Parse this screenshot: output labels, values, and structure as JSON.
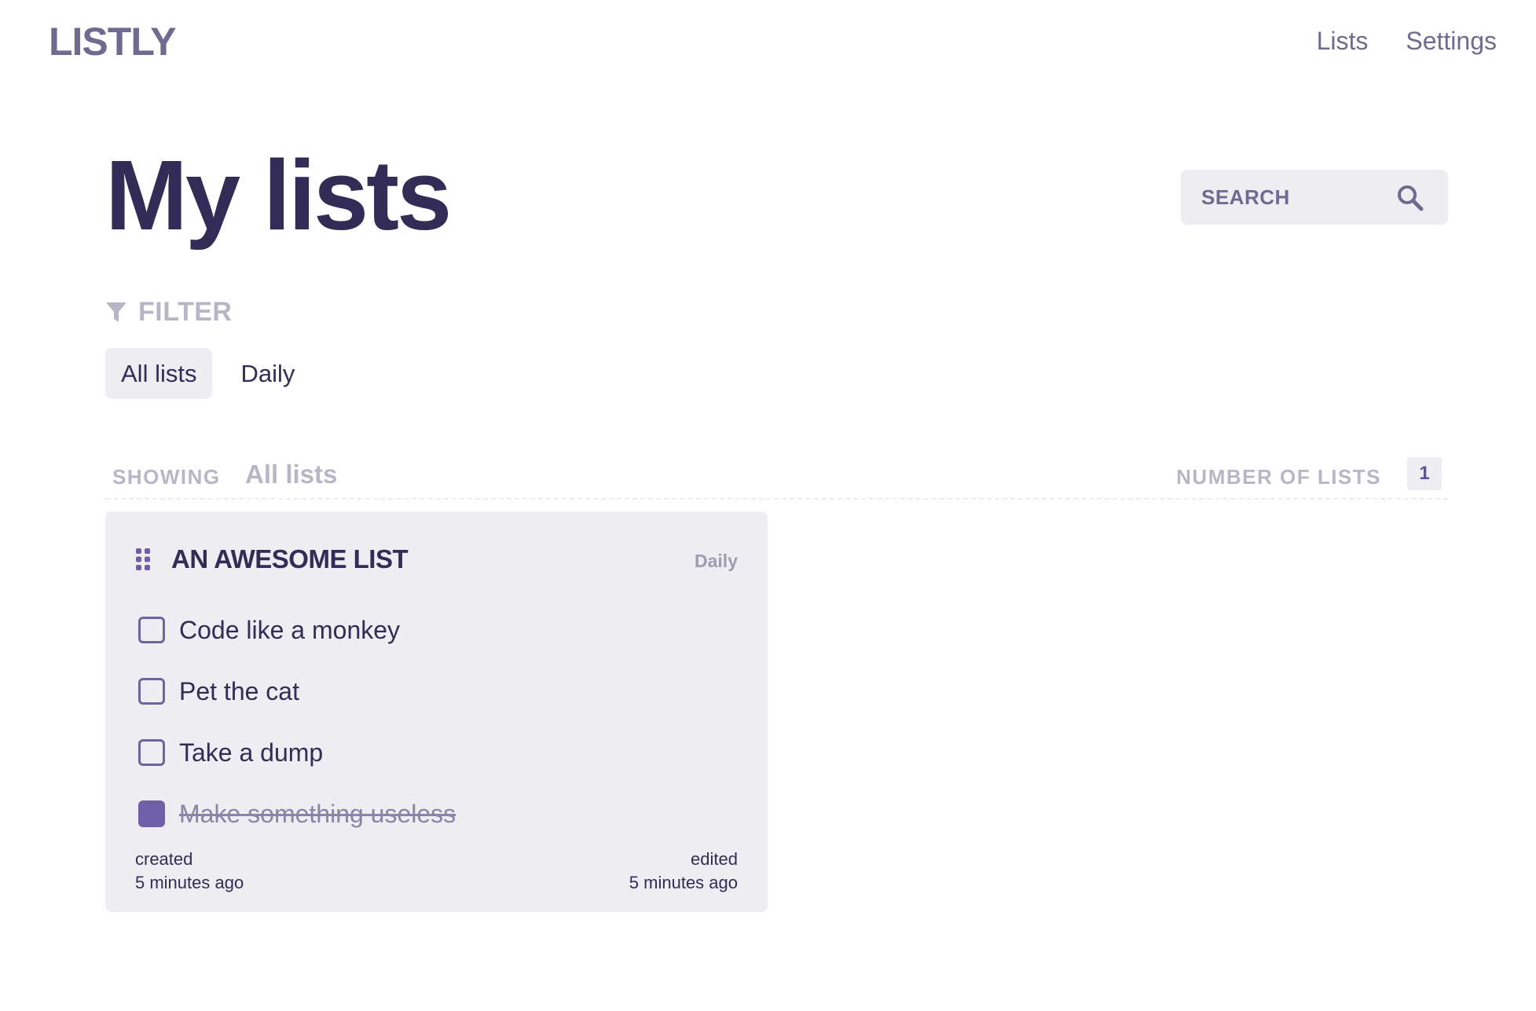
{
  "header": {
    "logo": "LISTLY",
    "nav": [
      {
        "label": "Lists"
      },
      {
        "label": "Settings"
      }
    ]
  },
  "main": {
    "title": "My lists",
    "search": {
      "placeholder": "SEARCH",
      "icon": "search-icon"
    },
    "filter": {
      "label": "FILTER",
      "icon": "filter-icon",
      "tabs": [
        {
          "label": "All lists",
          "active": true
        },
        {
          "label": "Daily",
          "active": false
        }
      ]
    },
    "showing": {
      "label": "SHOWING",
      "value": "All lists",
      "count_label": "NUMBER OF LISTS",
      "count": "1"
    },
    "lists": [
      {
        "title": "AN AWESOME LIST",
        "tag": "Daily",
        "items": [
          {
            "text": "Code like a monkey",
            "done": false
          },
          {
            "text": "Pet the cat",
            "done": false
          },
          {
            "text": "Take a dump",
            "done": false
          },
          {
            "text": "Make something useless",
            "done": true
          }
        ],
        "created_label": "created",
        "created_value": "5 minutes ago",
        "edited_label": "edited",
        "edited_value": "5 minutes ago"
      }
    ]
  },
  "colors": {
    "brand": "#6f6a90",
    "heading": "#332c56",
    "muted": "#b8b6c6",
    "panel": "#eeedf2",
    "accent": "#6f5fa6"
  }
}
